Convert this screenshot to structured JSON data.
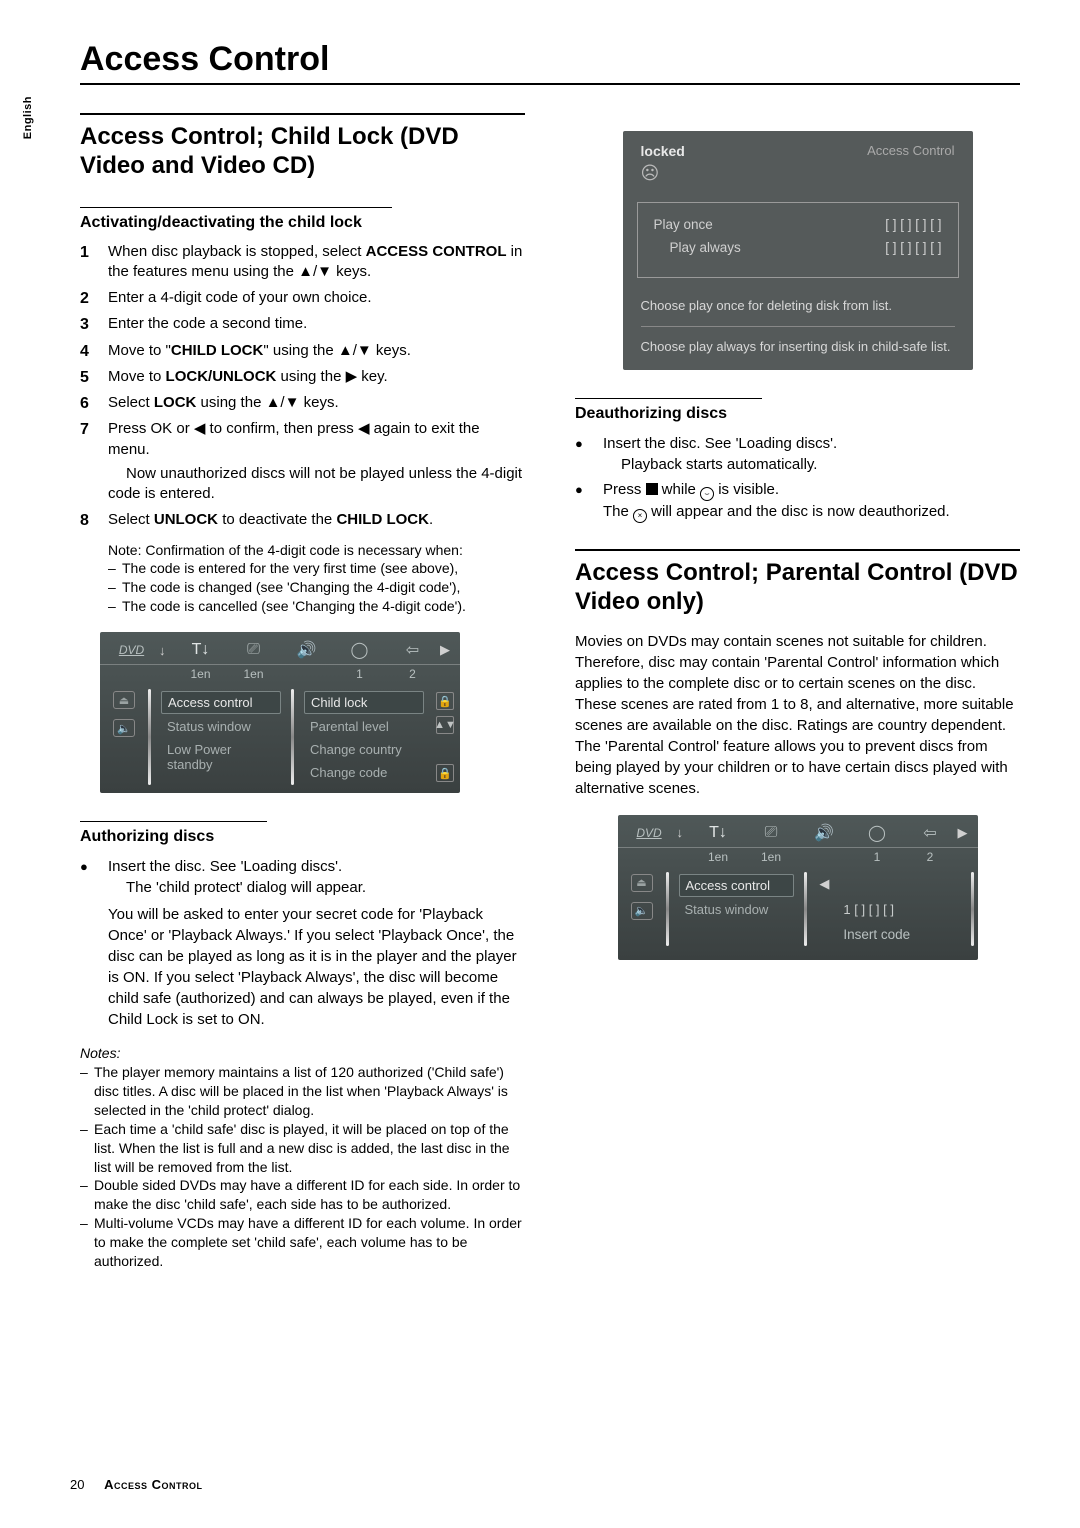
{
  "language_tab": "English",
  "page_title": "Access Control",
  "section1_title": "Access Control; Child Lock (DVD Video and Video CD)",
  "sub_activating": "Activating/deactivating the child lock",
  "steps": [
    {
      "pre": "When disc playback is stopped, select ",
      "b1": "ACCESS CONTROL",
      "mid": " in the features menu using the ▲/▼ keys.",
      "tail": ""
    },
    {
      "pre": "Enter a 4-digit code of your own choice."
    },
    {
      "pre": "Enter the code a second time."
    },
    {
      "pre": "Move to \"",
      "b1": "CHILD LOCK",
      "mid": "\" using the ▲/▼ keys."
    },
    {
      "pre": "Move to ",
      "b1": "LOCK/UNLOCK",
      "mid": " using the ▶ key."
    },
    {
      "pre": "Select ",
      "b1": "LOCK",
      "mid": " using the ▲/▼ keys."
    },
    {
      "pre": "Press OK or ◀ to confirm, then press ◀ again to exit the menu."
    }
  ],
  "step7_follow": "Now unauthorized discs will not be played unless the 4-digit code is entered.",
  "step8_pre": "Select ",
  "step8_b1": "UNLOCK",
  "step8_mid": " to deactivate the ",
  "step8_b2": "CHILD LOCK",
  "step8_tail": ".",
  "note_intro": "Note: Confirmation of the 4-digit code is necessary when:",
  "note_items": [
    "The code is entered for the very first time (see above),",
    "The code is changed (see 'Changing the 4-digit code'),",
    "The code is cancelled (see 'Changing the 4-digit code')."
  ],
  "osd1": {
    "tabs": [
      "1en",
      "1en",
      "1",
      "2"
    ],
    "left_menu": [
      "Access control",
      "Status window",
      "Low Power standby"
    ],
    "right_menu": [
      "Child lock",
      "Parental level",
      "Change country",
      "Change code"
    ]
  },
  "sub_authorizing": "Authorizing discs",
  "auth_b1": "Insert the disc. See 'Loading discs'.",
  "auth_b1_line2": "The 'child protect' dialog will appear.",
  "auth_para": "You will be asked to enter your secret code for 'Playback Once' or 'Playback Always.' If you select 'Playback Once', the disc can be played as long as it is in the player and the player is ON. If you select 'Playback Always', the disc will become child safe (authorized) and can always be played, even if the Child Lock is set to ON.",
  "notes_label": "Notes:",
  "notes_items": [
    "The player memory maintains a list of 120 authorized ('Child safe') disc titles. A disc will be placed in the list when 'Playback Always' is selected in the 'child protect' dialog.",
    "Each time a 'child safe' disc is played, it will be placed on top of the list. When the list is full and a new disc is added, the last disc in the list will be removed from the list.",
    "Double sided DVDs may have a different ID for each side. In order to make the disc 'child safe', each side has to be authorized.",
    "Multi-volume VCDs may have a different ID for each volume. In order to make the complete set 'child safe', each volume has to be authorized."
  ],
  "osd2": {
    "locked": "locked",
    "acc": "Access Control",
    "play_once": "Play once",
    "play_always": "Play always",
    "slots": "[ ]  [ ]  [ ]  [ ]",
    "msg1": "Choose play once for deleting disk from list.",
    "msg2": "Choose play always for inserting disk in child-safe list."
  },
  "sub_deauth": "Deauthorizing discs",
  "deauth_b1": "Insert the disc. See 'Loading discs'.",
  "deauth_b1_line2": "Playback starts automatically.",
  "deauth_b2_pre": "Press ",
  "deauth_b2_mid": " while ",
  "deauth_b2_tail": " is visible.",
  "deauth_b2_line2_pre": "The ",
  "deauth_b2_line2_tail": " will appear and the disc is now deauthorized.",
  "section2_title": "Access Control; Parental Control (DVD Video only)",
  "parental_para": "Movies on DVDs may contain scenes not suitable for children. Therefore, disc may contain 'Parental Control' information which applies to the complete disc or to certain scenes on the disc. These scenes are rated from 1 to 8, and alternative, more suitable scenes are available on the disc. Ratings are country dependent. The 'Parental Control' feature allows you to prevent discs from being played by your children or to have certain discs played with alternative scenes.",
  "osd3": {
    "tabs": [
      "1en",
      "1en",
      "1",
      "2"
    ],
    "left_menu": [
      "Access control",
      "Status window"
    ],
    "value_slots": "1   [ ]  [ ]  [ ]",
    "insert_code": "Insert code"
  },
  "footer_page": "20",
  "footer_label": "Access Control"
}
